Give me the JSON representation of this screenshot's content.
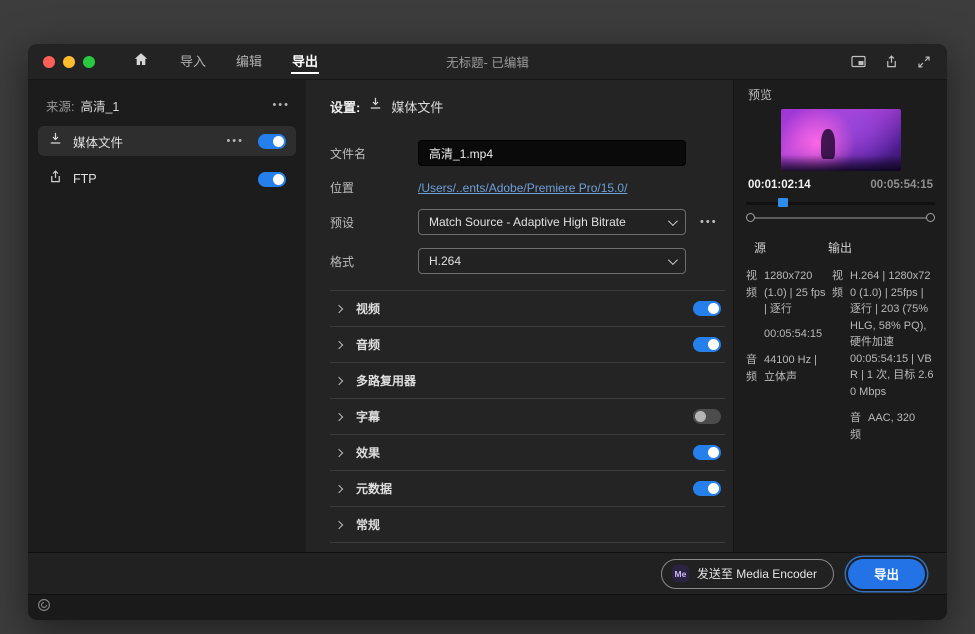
{
  "titlebar": {
    "title": "无标题- 已编辑",
    "tabs": [
      {
        "label": "导入"
      },
      {
        "label": "编辑"
      },
      {
        "label": "导出"
      }
    ]
  },
  "source_panel": {
    "header_label": "来源:",
    "source_name": "高清_1",
    "items": [
      {
        "label": "媒体文件",
        "icon": "export-media-icon",
        "toggle": "on"
      },
      {
        "label": "FTP",
        "icon": "share-icon",
        "toggle": "on"
      }
    ]
  },
  "settings": {
    "header_label": "设置:",
    "header_icon": "export-media-icon",
    "header_target": "媒体文件",
    "filename": {
      "label": "文件名",
      "value": "高清_1.mp4"
    },
    "location": {
      "label": "位置",
      "value": "/Users/..ents/Adobe/Premiere Pro/15.0/"
    },
    "preset": {
      "label": "预设",
      "value": "Match Source - Adaptive High Bitrate"
    },
    "format": {
      "label": "格式",
      "value": "H.264"
    },
    "sections": [
      {
        "label": "视频",
        "toggle": "on"
      },
      {
        "label": "音频",
        "toggle": "on"
      },
      {
        "label": "多路复用器",
        "toggle": "none"
      },
      {
        "label": "字幕",
        "toggle": "off"
      },
      {
        "label": "效果",
        "toggle": "on"
      },
      {
        "label": "元数据",
        "toggle": "on"
      },
      {
        "label": "常规",
        "toggle": "none"
      }
    ]
  },
  "preview": {
    "label": "预览",
    "current_time": "00:01:02:14",
    "duration": "00:05:54:15",
    "source_col": {
      "header": "源",
      "video_label": "视频",
      "video_value": "1280x720 (1.0) | 25 fps | 逐行",
      "video_duration": "00:05:54:15",
      "audio_label": "音频",
      "audio_value": "44100 Hz | 立体声"
    },
    "output_col": {
      "header": "输出",
      "video_label": "视频",
      "video_value": "H.264 | 1280x720 (1.0) | 25fps | 逐行 | 203 (75% HLG, 58% PQ), 硬件加速",
      "video_extra": "00:05:54:15 | VBR | 1 次, 目标 2.60 Mbps",
      "audio_label": "音频",
      "audio_value": "AAC, 320"
    }
  },
  "footer": {
    "send_button": "发送至 Media Encoder",
    "send_badge": "Me",
    "export_button": "导出"
  },
  "colors": {
    "accent_blue": "#2680eb",
    "link_blue": "#6f9fd8"
  }
}
